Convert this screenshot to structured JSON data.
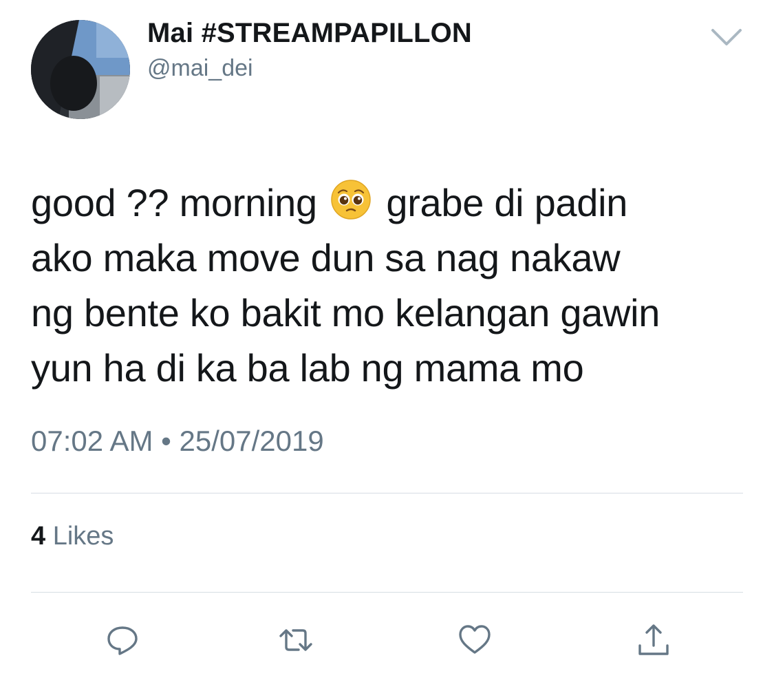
{
  "tweet": {
    "display_name": "Mai #STREAMPAPILLON",
    "handle": "@mai_dei",
    "text_lines": {
      "l1a": "good ?? morning",
      "l1b": "grabe di padin",
      "l2": "ako maka move dun sa nag nakaw",
      "l3": "ng bente ko bakit mo kelangan gawin",
      "l4": "yun ha di ka ba lab ng mama mo"
    },
    "emoji": "pleading-face",
    "time": "07:02 AM",
    "separator": "•",
    "date": "25/07/2019",
    "likes_count": "4",
    "likes_label": "Likes"
  },
  "icons": {
    "menu": "chevron-down-icon",
    "reply": "reply-icon",
    "retweet": "retweet-icon",
    "like": "heart-icon",
    "share": "share-icon"
  },
  "colors": {
    "text_primary": "#14171a",
    "text_secondary": "#657786",
    "divider": "#d6dde3",
    "icon": "#657786",
    "emoji_face": "#f7c237"
  }
}
